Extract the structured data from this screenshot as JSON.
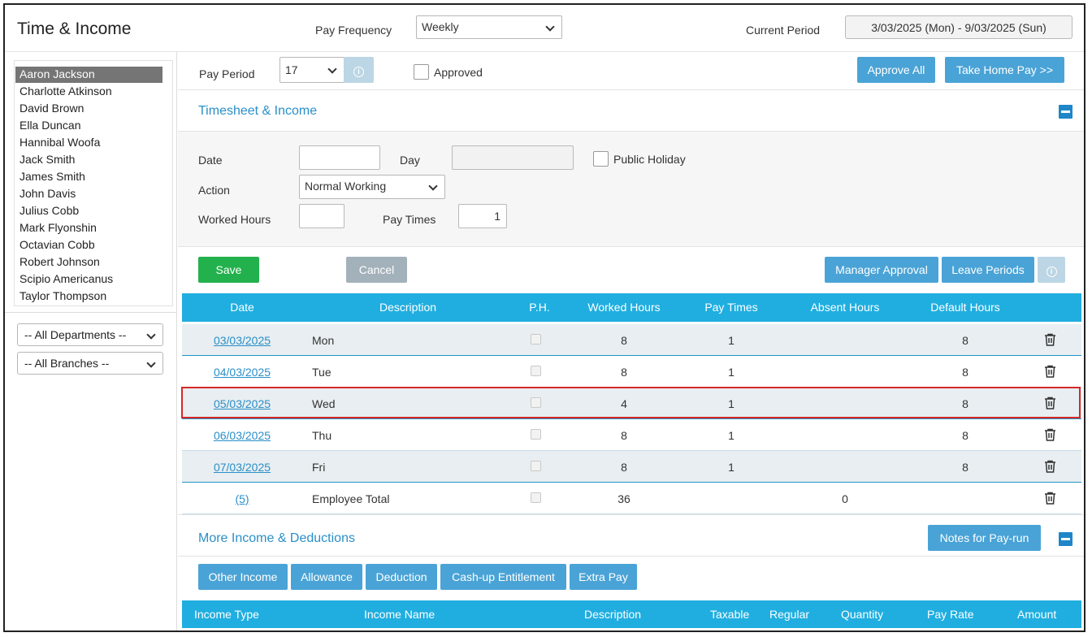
{
  "header": {
    "title": "Time & Income",
    "pay_frequency_label": "Pay Frequency",
    "pay_frequency_value": "Weekly",
    "current_period_label": "Current Period",
    "current_period_value": "3/03/2025 (Mon) - 9/03/2025 (Sun)"
  },
  "sidebar": {
    "employees": [
      "Aaron Jackson",
      "Charlotte Atkinson",
      "David Brown",
      "Ella Duncan",
      "Hannibal Woofa",
      "Jack Smith",
      "James Smith",
      "John Davis",
      "Julius Cobb",
      "Mark Flyonshin",
      "Octavian Cobb",
      "Robert Johnson",
      "Scipio Americanus",
      "Taylor Thompson"
    ],
    "departments": "-- All Departments --",
    "branches": "-- All Branches --"
  },
  "toolbar": {
    "pay_period_label": "Pay Period",
    "pay_period_value": "17",
    "approved_label": "Approved",
    "approve_all": "Approve All",
    "take_home_pay": "Take Home Pay >>"
  },
  "timesheet": {
    "title": "Timesheet & Income",
    "date_label": "Date",
    "day_label": "Day",
    "public_holiday_label": "Public Holiday",
    "action_label": "Action",
    "action_value": "Normal Working",
    "worked_hours_label": "Worked Hours",
    "pay_times_label": "Pay Times",
    "pay_times_value": "1",
    "save": "Save",
    "cancel": "Cancel",
    "manager_approval": "Manager Approval",
    "leave_periods": "Leave Periods",
    "columns": [
      "Date",
      "Description",
      "P.H.",
      "Worked Hours",
      "Pay Times",
      "Absent Hours",
      "Default Hours"
    ],
    "rows": [
      {
        "date": "03/03/2025",
        "desc": "Mon",
        "worked": "8",
        "pay_times": "1",
        "absent": "",
        "default": "8"
      },
      {
        "date": "04/03/2025",
        "desc": "Tue",
        "worked": "8",
        "pay_times": "1",
        "absent": "",
        "default": "8"
      },
      {
        "date": "05/03/2025",
        "desc": "Wed",
        "worked": "4",
        "pay_times": "1",
        "absent": "",
        "default": "8"
      },
      {
        "date": "06/03/2025",
        "desc": "Thu",
        "worked": "8",
        "pay_times": "1",
        "absent": "",
        "default": "8"
      },
      {
        "date": "07/03/2025",
        "desc": "Fri",
        "worked": "8",
        "pay_times": "1",
        "absent": "",
        "default": "8"
      }
    ],
    "total": {
      "date": "(5)",
      "desc": "Employee Total",
      "worked": "36",
      "pay_times": "",
      "absent": "0",
      "default": ""
    }
  },
  "income": {
    "title": "More Income & Deductions",
    "notes_button": "Notes for Pay-run",
    "tabs": [
      "Other Income",
      "Allowance",
      "Deduction",
      "Cash-up Entitlement",
      "Extra Pay"
    ],
    "columns": [
      "Income Type",
      "Income Name",
      "Description",
      "Taxable",
      "Regular",
      "Quantity",
      "Pay Rate",
      "Amount"
    ]
  },
  "colors": {
    "accent": "#20aee0",
    "button_blue": "#4aa3d6",
    "save_green": "#22b14c",
    "highlight": "#d62828"
  }
}
